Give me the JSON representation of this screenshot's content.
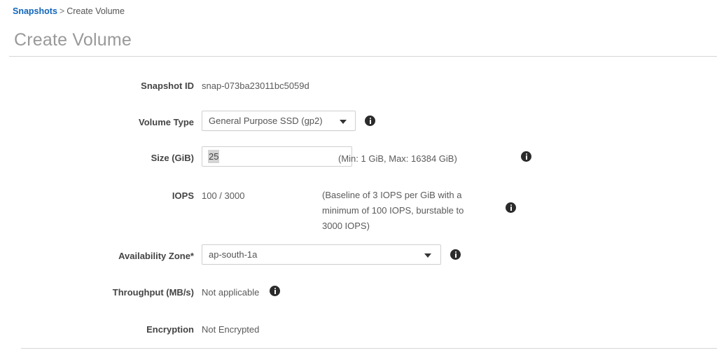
{
  "breadcrumb": {
    "link_label": "Snapshots",
    "separator": ">",
    "current_label": "Create Volume"
  },
  "page": {
    "title": "Create Volume"
  },
  "form": {
    "snapshot_id": {
      "label": "Snapshot ID",
      "value": "snap-073ba23011bc5059d"
    },
    "volume_type": {
      "label": "Volume Type",
      "value": "General Purpose SSD (gp2)",
      "options": [
        "General Purpose SSD (gp2)"
      ]
    },
    "size": {
      "label": "Size (GiB)",
      "value": "25",
      "hint": "(Min: 1 GiB, Max: 16384 GiB)"
    },
    "iops": {
      "label": "IOPS",
      "value": "100 / 3000",
      "hint_line1": "(Baseline of 3 IOPS per GiB with a",
      "hint_line2": "minimum of 100 IOPS, burstable to",
      "hint_line3": "3000 IOPS)"
    },
    "availability_zone": {
      "label": "Availability Zone*",
      "value": "ap-south-1a",
      "options": [
        "ap-south-1a"
      ]
    },
    "throughput": {
      "label": "Throughput (MB/s)",
      "value": "Not applicable"
    },
    "encryption": {
      "label": "Encryption",
      "value": "Not Encrypted"
    }
  },
  "icons": {
    "info": "info-icon",
    "caret": "chevron-down-icon"
  },
  "colors": {
    "link": "#1166bb",
    "title": "#999999",
    "label": "#444444",
    "value": "#5a5a5a",
    "border": "#cfcfcf",
    "rule": "#d5d5d5",
    "info_badge": "#2b2b2b",
    "selection": "#d4d4d4"
  }
}
